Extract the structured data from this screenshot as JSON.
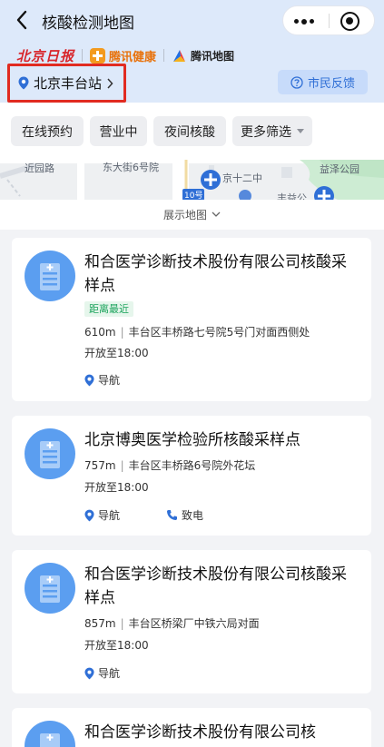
{
  "header": {
    "title": "核酸检测地图"
  },
  "brands": {
    "beijing_daily": "北京日报",
    "tencent_health": "腾讯健康",
    "tencent_map": "腾讯地图"
  },
  "location": {
    "label": "北京丰台站"
  },
  "feedback": {
    "label": "市民反馈"
  },
  "filters": [
    {
      "label": "在线预约"
    },
    {
      "label": "营业中"
    },
    {
      "label": "夜间核酸"
    },
    {
      "label": "更多筛选"
    }
  ],
  "map": {
    "labels": [
      "近园路",
      "东大街6号院",
      "京十二中",
      "益泽公园",
      "10号",
      "丰益公"
    ]
  },
  "expand_map": {
    "label": "展示地图"
  },
  "actions": {
    "navigate": "导航",
    "call": "致电"
  },
  "sites": [
    {
      "name": "和合医学诊断技术股份有限公司核酸采样点",
      "badge": "距离最近",
      "distance": "610m",
      "address": "丰台区丰桥路七号院5号门对面西侧处",
      "hours": "开放至18:00"
    },
    {
      "name": "北京博奥医学检验所核酸采样点",
      "distance": "757m",
      "address": "丰台区丰桥路6号院外花坛",
      "hours": "开放至18:00"
    },
    {
      "name": "和合医学诊断技术股份有限公司核酸采样点",
      "distance": "857m",
      "address": "丰台区桥梁厂中铁六局对面",
      "hours": "开放至18:00"
    },
    {
      "name": "和合医学诊断技术股份有限公司核"
    }
  ],
  "colors": {
    "accent": "#2f6fd6",
    "highlight_border": "#e12b21",
    "badge_green": "#1aa35b"
  }
}
